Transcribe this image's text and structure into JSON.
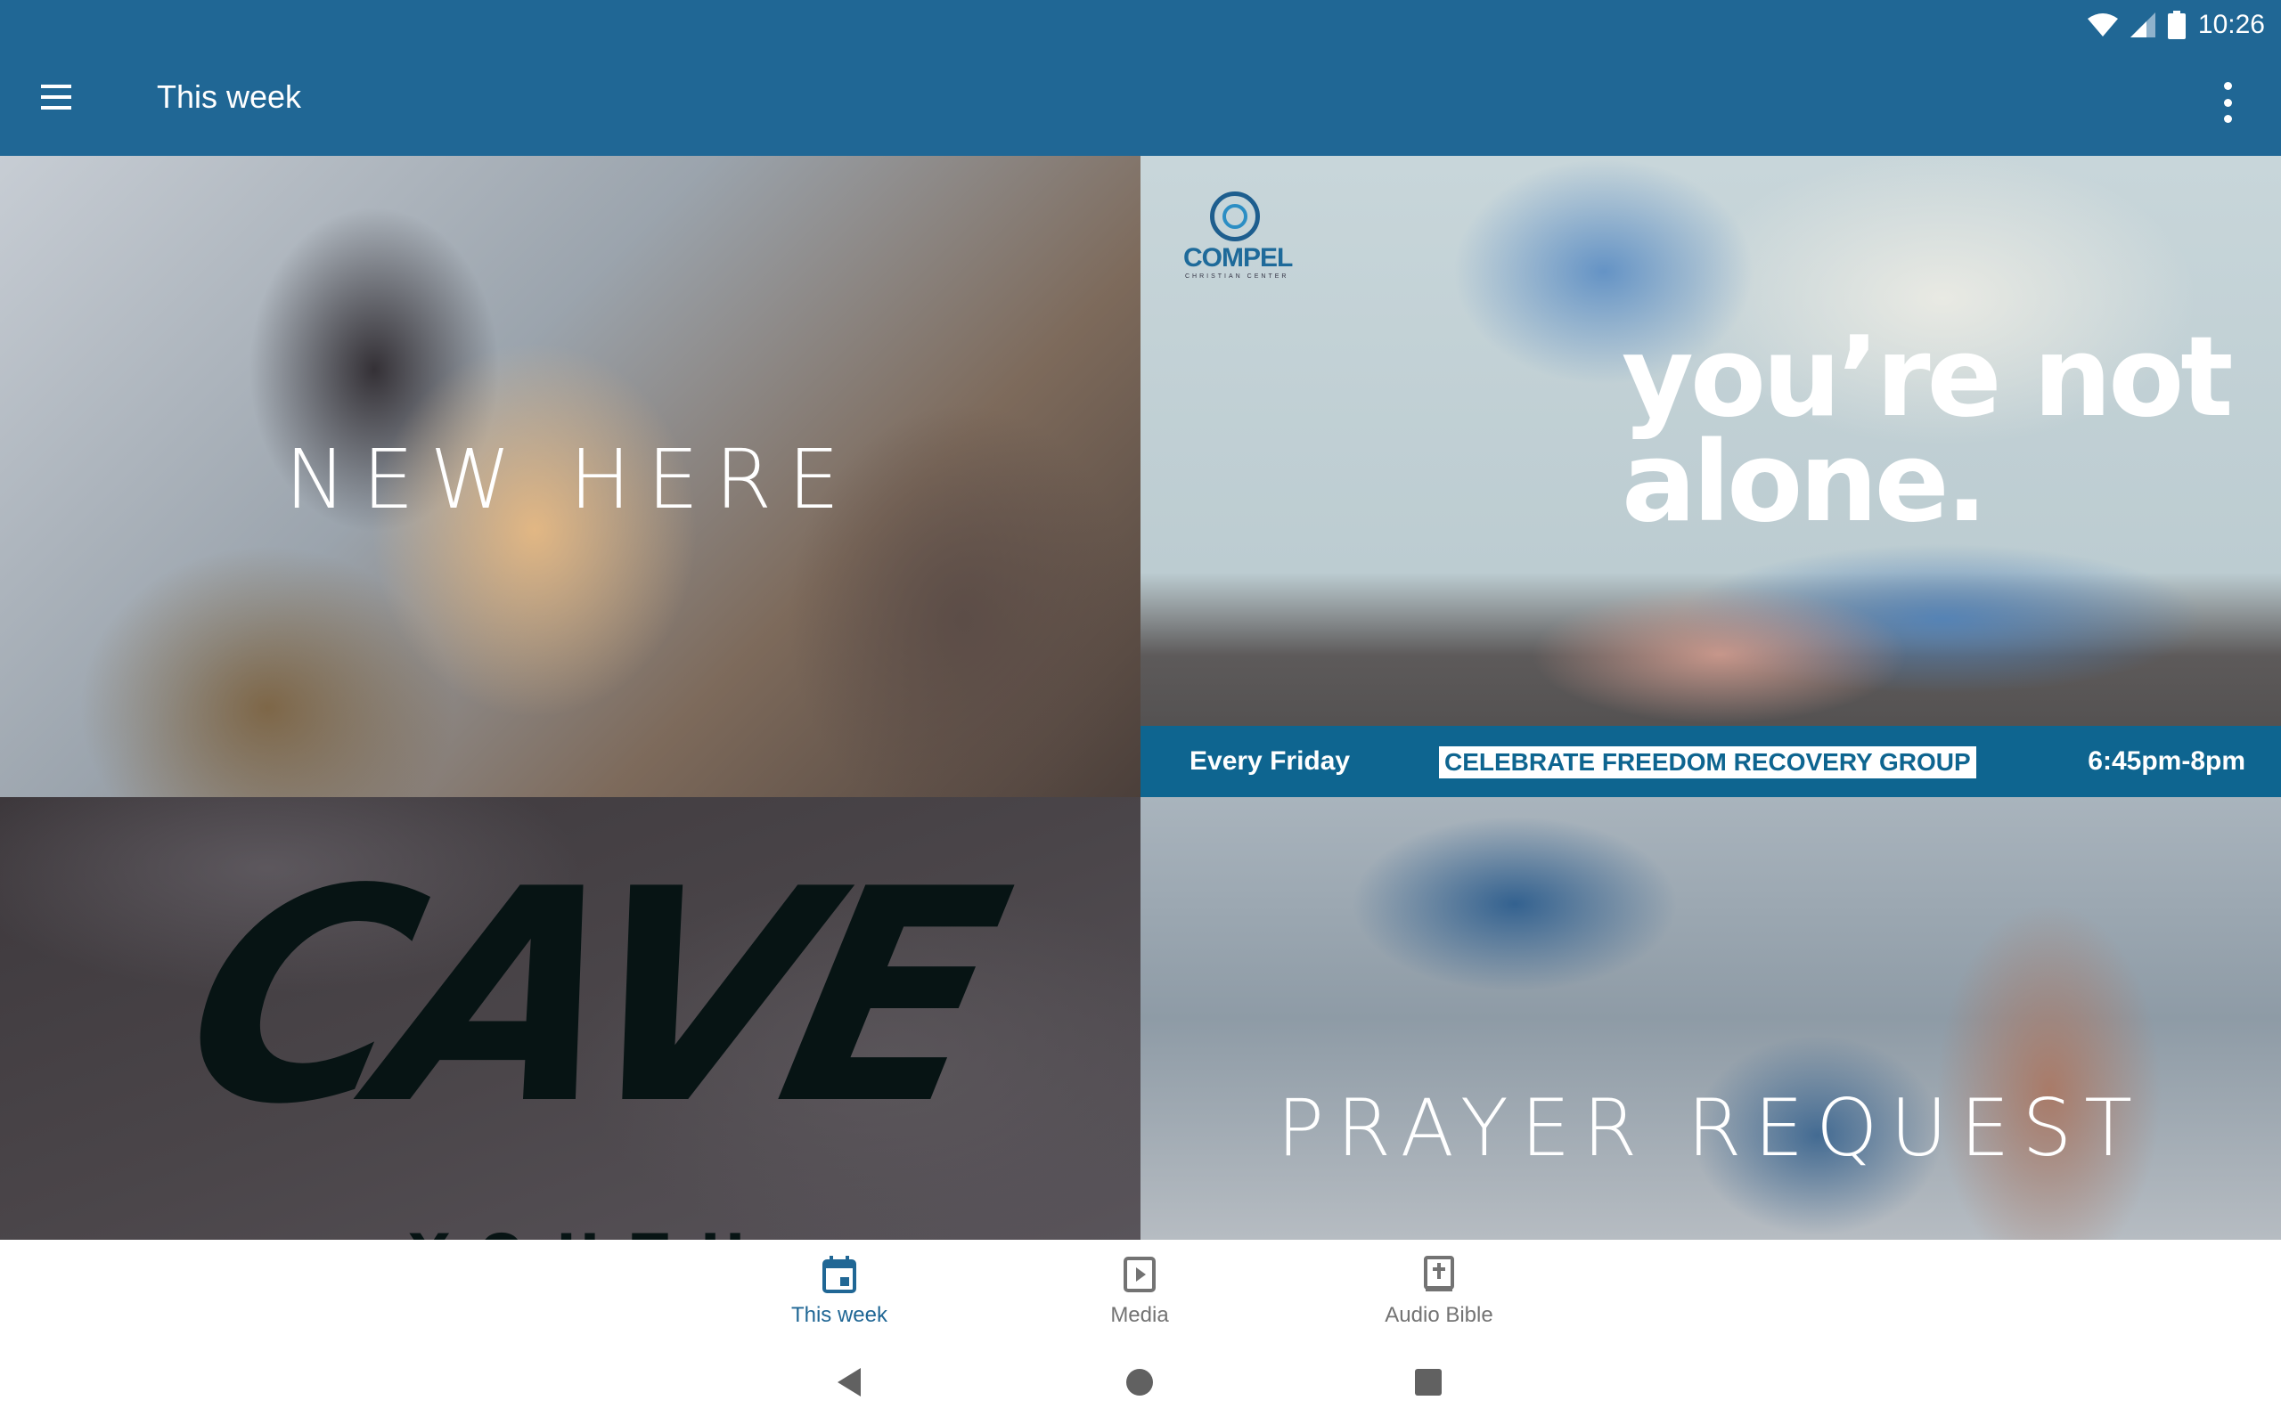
{
  "status_bar": {
    "time": "10:26",
    "icons": [
      "wifi-icon",
      "signal-icon",
      "battery-icon"
    ]
  },
  "app_bar": {
    "title": "This week",
    "menu_icon": "hamburger-icon",
    "overflow_icon": "more-vert-icon"
  },
  "tiles": [
    {
      "label": "NEW HERE"
    },
    {
      "logo": {
        "name": "COMPEL",
        "subtitle": "CHRISTIAN CENTER"
      },
      "headline": [
        "you’re not",
        "alone."
      ],
      "band": {
        "day": "Every Friday",
        "group": "CELEBRATE FREEDOM RECOVERY GROUP",
        "time": "6:45pm-8pm"
      }
    },
    {
      "title": "CAVE",
      "subtitle": "YOUTH"
    },
    {
      "label": "PRAYER REQUEST"
    }
  ],
  "bottom_nav": [
    {
      "label": "This week",
      "icon": "calendar-icon",
      "active": true
    },
    {
      "label": "Media",
      "icon": "play-box-icon",
      "active": false
    },
    {
      "label": "Audio Bible",
      "icon": "bible-icon",
      "active": false
    }
  ],
  "colors": {
    "primary": "#206795",
    "band": "#0e6590",
    "inactive": "#737373",
    "system_nav": "#616161"
  }
}
